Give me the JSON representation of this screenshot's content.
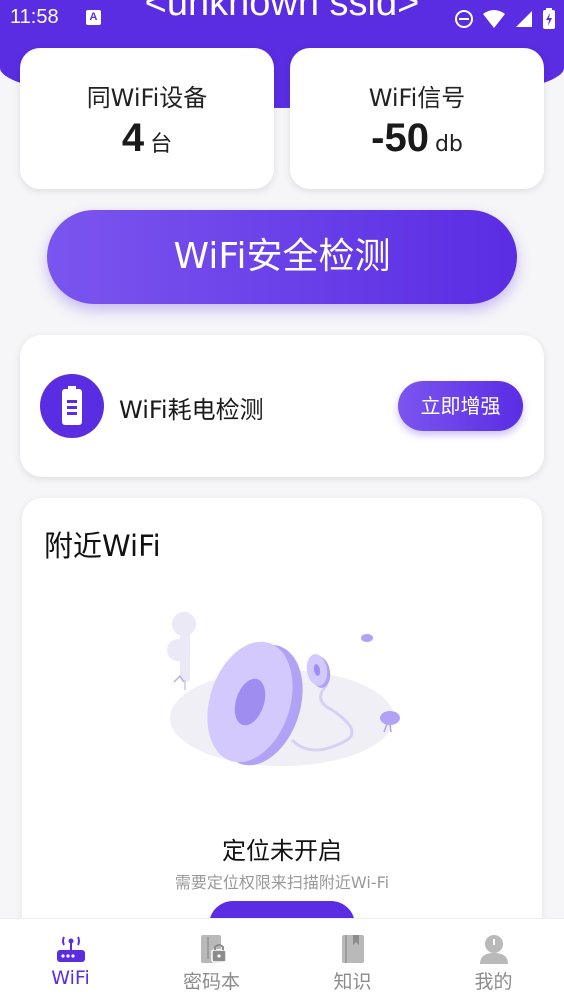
{
  "status_bar": {
    "time": "11:58",
    "ssid": "<unknown ssid>"
  },
  "stats": {
    "same_wifi_devices": {
      "label": "同WiFi设备",
      "value": "4",
      "unit": "台"
    },
    "wifi_signal": {
      "label": "WiFi信号",
      "value": "-50",
      "unit": "db"
    }
  },
  "main_button": {
    "label": "WiFi安全检测"
  },
  "power_check": {
    "label": "WiFi耗电检测",
    "button_label": "立即增强"
  },
  "nearby": {
    "title": "附近WiFi",
    "status_title": "定位未开启",
    "status_subtitle": "需要定位权限来扫描附近Wi-Fi"
  },
  "bottom_nav": {
    "items": [
      {
        "label": "WiFi",
        "icon": "router-icon",
        "active": true
      },
      {
        "label": "密码本",
        "icon": "password-book-icon",
        "active": false
      },
      {
        "label": "知识",
        "icon": "book-icon",
        "active": false
      },
      {
        "label": "我的",
        "icon": "user-icon",
        "active": false
      }
    ]
  },
  "colors": {
    "accent": "#5a2de3",
    "accent_light": "#7b55ef",
    "background": "#f6f6f8",
    "inactive_nav": "#8c8c8c"
  }
}
